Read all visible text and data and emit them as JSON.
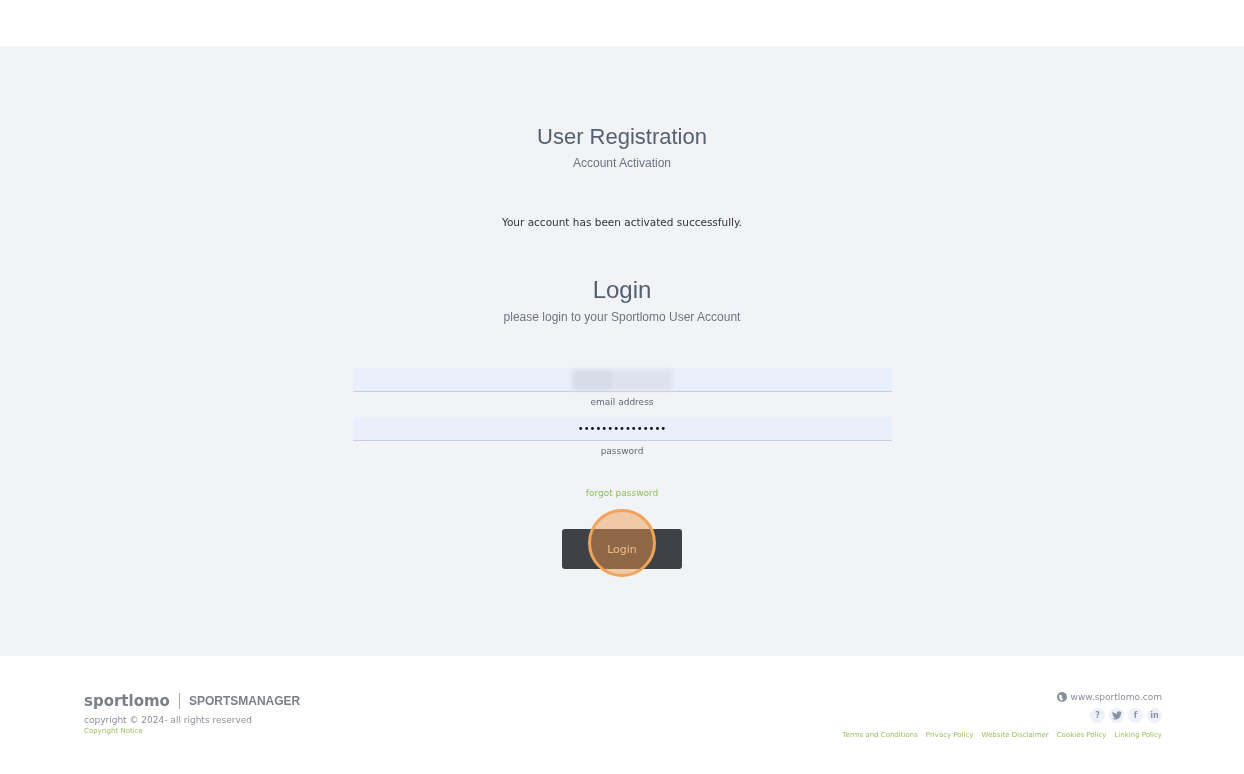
{
  "header": {
    "title": "User Registration",
    "subtitle": "Account Activation"
  },
  "message": "Your account has been activated successfully.",
  "login": {
    "title": "Login",
    "subtitle": "please login to your Sportlomo User Account",
    "fields": [
      {
        "kind": "email",
        "label": "email address",
        "redacted": true
      },
      {
        "kind": "password",
        "value": "•••••••••••••••",
        "label": "password"
      }
    ],
    "forgot_link": "forgot password",
    "button": "Login",
    "click_highlight": true
  },
  "footer": {
    "brand": "sportlomo",
    "product": "SPORTSMANAGER",
    "copyright": "copyright © 2024- all rights reserved",
    "copyright_link": "Copyright Notice",
    "website": "www.sportlomo.com",
    "social": [
      {
        "kind": "help",
        "glyph": "?"
      },
      {
        "kind": "twitter"
      },
      {
        "kind": "facebook",
        "glyph": "f"
      },
      {
        "kind": "linkedin",
        "glyph": "in"
      }
    ],
    "links": [
      "Terms and Conditions",
      "Privacy Policy",
      "Website Disclaimer",
      "Cookies Policy",
      "Linking Policy"
    ]
  }
}
